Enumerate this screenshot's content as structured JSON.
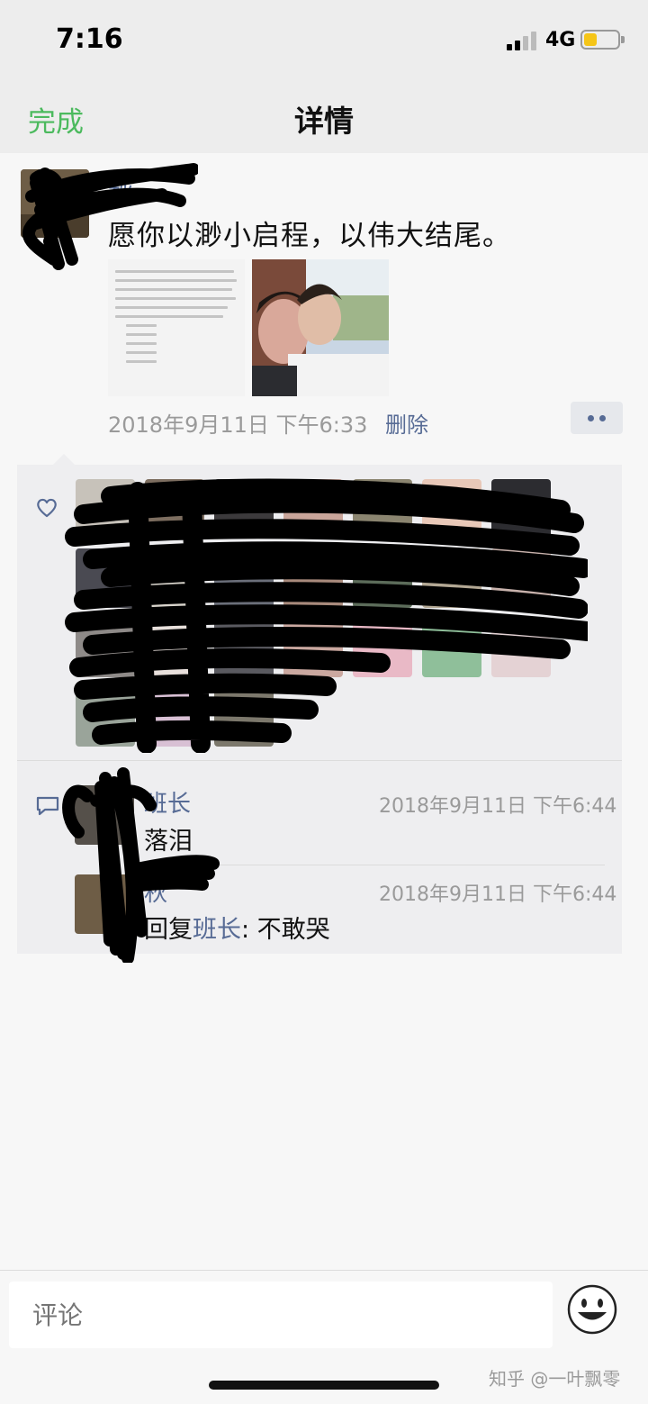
{
  "status_bar": {
    "time": "7:16",
    "network": "4G",
    "battery_level": 0.3,
    "battery_color": "#f5c518"
  },
  "nav": {
    "done_label": "完成",
    "title": "详情"
  },
  "post": {
    "author": "秋",
    "text": "愿你以渺小启程，以伟大结尾。",
    "time": "2018年9月11日 下午6:33",
    "delete_label": "删除",
    "more_icon": "more-dots-icon"
  },
  "likes": {
    "icon": "heart-icon"
  },
  "comments": [
    {
      "name": "班长",
      "time": "2018年9月11日 下午6:44",
      "text": "落泪"
    },
    {
      "name": "秋",
      "time": "2018年9月11日 下午6:44",
      "reply_prefix": "回复",
      "reply_to": "班长",
      "reply_text": ": 不敢哭"
    }
  ],
  "bottom": {
    "comment_placeholder": "评论",
    "emoji_icon": "smiley-icon",
    "watermark": "知乎 @一叶飘零"
  },
  "colors": {
    "accent_green": "#4cba5e",
    "link_blue": "#576b95",
    "meta_gray": "#9a9a9a"
  }
}
